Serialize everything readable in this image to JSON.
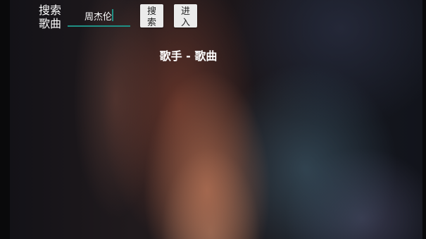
{
  "search": {
    "label": "搜索歌曲",
    "value": "周杰伦"
  },
  "buttons": {
    "search_label": "搜索",
    "enter_label": "进入"
  },
  "now_playing": {
    "text": "歌手 - 歌曲"
  },
  "colors": {
    "accent": "#1f8f84",
    "button_bg": "#ebebeb",
    "text": "#ffffff"
  }
}
